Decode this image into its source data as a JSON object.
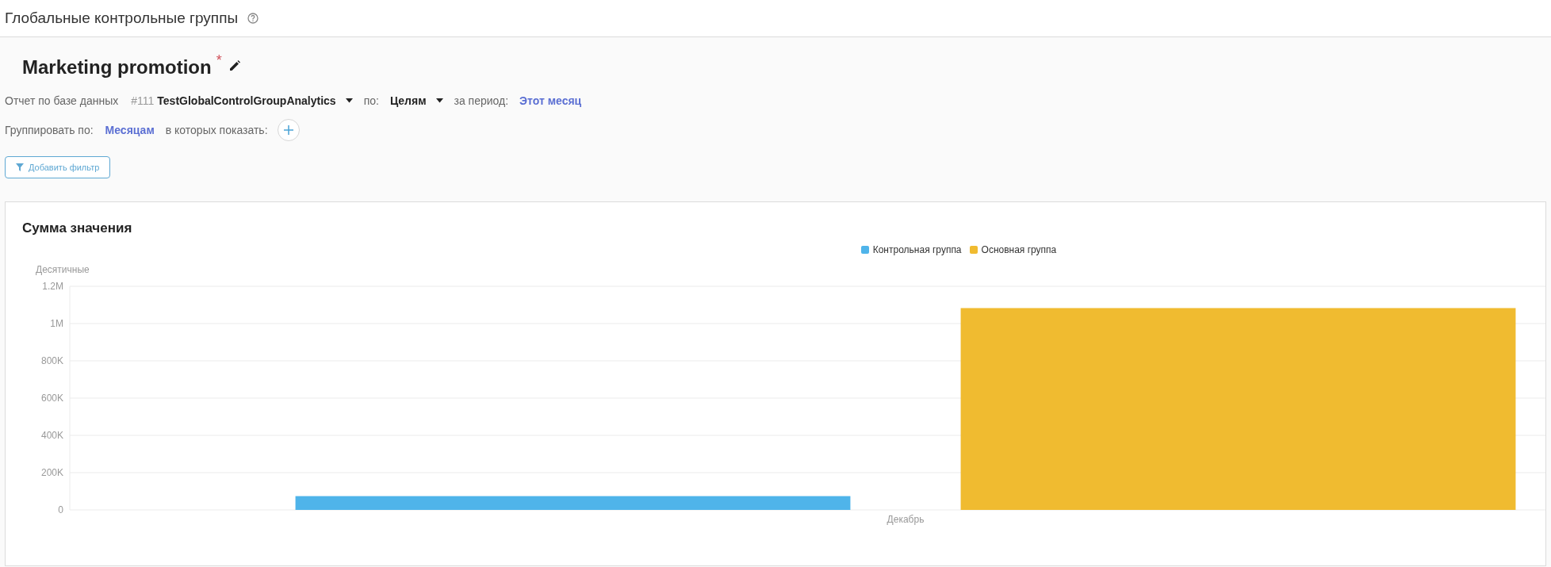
{
  "header": {
    "title": "Глобальные контрольные группы"
  },
  "report": {
    "name": "Marketing promotion",
    "required_mark": "*"
  },
  "source": {
    "label": "Отчет по базе данных",
    "id": "#111",
    "value": "TestGlobalControlGroupAnalytics"
  },
  "by": {
    "label": "по:",
    "value": "Целям"
  },
  "period": {
    "label": "за период:",
    "value": "Этот месяц"
  },
  "group_by": {
    "label": "Группировать по:",
    "value": "Месяцам"
  },
  "show_in": {
    "label": "в которых показать:"
  },
  "add_filter_button": "Добавить фильтр",
  "chart": {
    "title": "Сумма значения",
    "chart_data": {
      "type": "bar",
      "grid": true,
      "ylabel": "Десятичные",
      "categories": [
        "Декабрь"
      ],
      "series": [
        {
          "name": "Контрольная группа",
          "color": "#4fb4ea",
          "values": [
            74000
          ]
        },
        {
          "name": "Основная группа",
          "color": "#f0bb30",
          "values": [
            1083000
          ]
        }
      ],
      "ylim": [
        0,
        1200000
      ],
      "yticks": [
        {
          "value": 0,
          "label": "0"
        },
        {
          "value": 200000,
          "label": "200K"
        },
        {
          "value": 400000,
          "label": "400K"
        },
        {
          "value": 600000,
          "label": "600K"
        },
        {
          "value": 800000,
          "label": "800K"
        },
        {
          "value": 1000000,
          "label": "1M"
        },
        {
          "value": 1200000,
          "label": "1.2M"
        }
      ]
    }
  }
}
